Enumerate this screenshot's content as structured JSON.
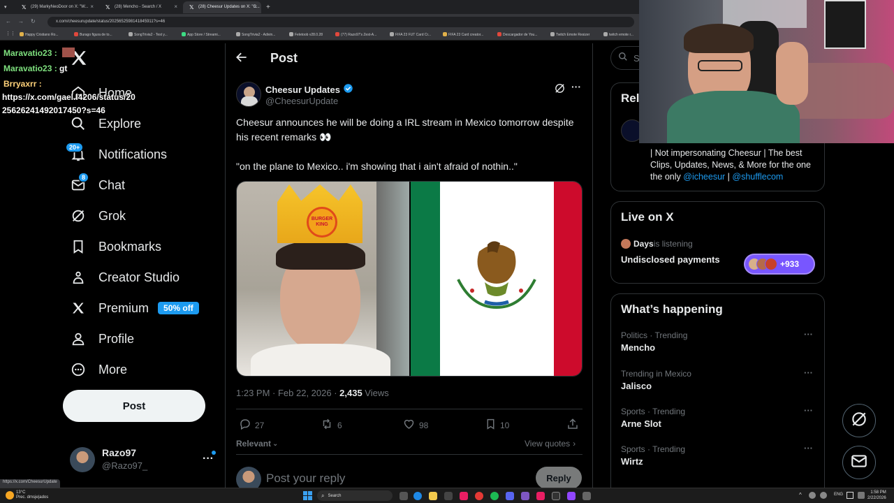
{
  "browser": {
    "tabs": [
      {
        "label": "(29) MarkyNeoDoor on X: \"W..."
      },
      {
        "label": "(28) Mencho - Search / X"
      },
      {
        "label": "(28) Cheesur Updates on X: \"C..."
      }
    ],
    "url": "x.com/cheesurupdate/status/2025652598141845911?s=46",
    "bookmarks": [
      "Happy Cristiano Ro...",
      "Burago figura de to...",
      "SongTrivia2 - Test y...",
      "App Store / Streami...",
      "SongTrivia2 - Adivin...",
      "Feletoob v28.0.28",
      "(77) Razo97's Zest-A...",
      "FIFA 23 FUT Card Cr...",
      "FIFA 23 Card creator...",
      "Descargador de You...",
      "Twitch Emote Resizer",
      "twitch emote r..."
    ],
    "status_url": "https://x.com/CheesurUpdate"
  },
  "nav": {
    "items": [
      {
        "label": "Home",
        "icon": "home-icon"
      },
      {
        "label": "Explore",
        "icon": "search-icon"
      },
      {
        "label": "Notifications",
        "icon": "bell-icon",
        "badge": "20+"
      },
      {
        "label": "Chat",
        "icon": "mail-icon",
        "badge": "8"
      },
      {
        "label": "Grok",
        "icon": "grok-icon"
      },
      {
        "label": "Bookmarks",
        "icon": "bookmark-icon"
      },
      {
        "label": "Creator Studio",
        "icon": "creator-icon"
      },
      {
        "label": "Premium",
        "icon": "x-icon",
        "pill": "50% off"
      },
      {
        "label": "Profile",
        "icon": "person-icon"
      },
      {
        "label": "More",
        "icon": "more-circle-icon"
      }
    ],
    "post_button": "Post",
    "account": {
      "name": "Razo97",
      "handle": "@Razo97_"
    }
  },
  "header": {
    "title": "Post"
  },
  "post": {
    "author": "Cheesur Updates",
    "handle": "@CheesurUpdate",
    "text1": "Cheesur announces he will be doing a IRL stream in Mexico tomorrow despite his recent remarks 👀",
    "text2": "\"on the plane to Mexico.. i'm showing that i ain't afraid of nothin..\"",
    "crown_text": "BURGER KING",
    "meta_time": "1:23 PM · Feb 22, 2026 · ",
    "views_count": "2,435",
    "views_label": " Views",
    "replies": "27",
    "reposts": "6",
    "likes": "98",
    "bookmarks": "10",
    "sort_label": "Relevant",
    "view_quotes": "View quotes",
    "reply_placeholder": "Post your reply",
    "reply_button": "Reply"
  },
  "sidebar": {
    "search_placeholder": "Se",
    "relevant_title": "Rel",
    "bio": "| Not impersonating Cheesur | The best Clips, Updates, News, & More for the one the only ",
    "bio_link1": "@icheesur",
    "bio_sep": " | ",
    "bio_link2": "@shufflecom",
    "live": {
      "title": "Live on X",
      "host": "Days",
      "status": " is listening",
      "space_title": "Undisclosed payments",
      "count": "+933"
    },
    "happening": {
      "title": "What’s happening",
      "trends": [
        {
          "context": "Politics · Trending",
          "name": "Mencho"
        },
        {
          "context": "Trending in Mexico",
          "name": "Jalisco"
        },
        {
          "context": "Sports · Trending",
          "name": "Arne Slot"
        },
        {
          "context": "Sports · Trending",
          "name": "Wirtz"
        }
      ]
    }
  },
  "chat_overlay": [
    {
      "user": "Maravatio23 :",
      "msg": "",
      "color": "#7ee07e"
    },
    {
      "user": "Maravatio23 :",
      "msg": " gt",
      "color": "#7ee07e"
    },
    {
      "user": "Brryaxrr :",
      "msg": "",
      "color": "#ffd27a"
    },
    {
      "user": "",
      "msg": "https://x.com/gael.l4206/status/20",
      "color": "#ffffff"
    },
    {
      "user": "",
      "msg": "2562624149201745​0?s=46",
      "color": "#ffffff"
    }
  ],
  "taskbar": {
    "weather_temp": "13°C",
    "weather_desc": "Prec. dmsje|ados",
    "search": "Search",
    "lang": "ENG",
    "time": "1:58 PM",
    "date": "2/22/2026"
  },
  "colors": {
    "accent": "#1d9bf0",
    "verified": "#1d9bf0",
    "live_pill": "#7856ff"
  }
}
